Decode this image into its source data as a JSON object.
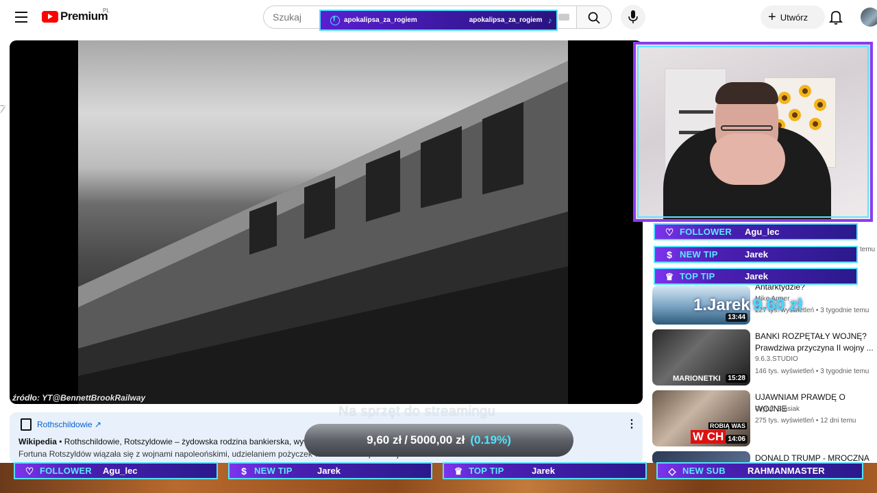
{
  "header": {
    "logo_text": "Premium",
    "region": "PL",
    "search_placeholder": "Szukaj",
    "create_label": "Utwórz"
  },
  "social_banner": {
    "facebook": "apokalipsa_za_rogiem",
    "tiktok": "apokalipsa_za_rogiem"
  },
  "video": {
    "credit": "źródło: YT@BennettBrookRailway"
  },
  "info_panel": {
    "title": "Rothschildowie ↗",
    "line1_source": "Wikipedia",
    "line1_text": " • Rothschildowie, Rotszyldowie – żydowska rodzina bankierska, wywodząca się z Frankfurtu nad Menem.",
    "line2_text": "Fortuna Rotszyldów wiązała się z wojnami napoleońskimi, udzielaniem pożyczek władcom i ze spekulacjami."
  },
  "right_alerts": [
    {
      "label": "FOLLOWER",
      "name": "Agu_lec",
      "icon": "heart-icon"
    },
    {
      "label": "NEW TIP",
      "name": "Jarek",
      "icon": "dollar-icon"
    },
    {
      "label": "TOP TIP",
      "name": "Jarek",
      "icon": "crown-icon"
    }
  ],
  "bottom_alerts": [
    {
      "label": "FOLLOWER",
      "name": "Agu_lec",
      "icon": "heart-icon"
    },
    {
      "label": "NEW TIP",
      "name": "Jarek",
      "icon": "dollar-icon"
    },
    {
      "label": "TOP TIP",
      "name": "Jarek",
      "icon": "crown-icon"
    },
    {
      "label": "NEW SUB",
      "name": "RAHMANMASTER",
      "icon": "diamond-icon"
    }
  ],
  "recommendations": [
    {
      "title": "Antarktydzie?",
      "channel": "Mike Armer",
      "meta": "227 tys. wyświetleń • 3 tygodnie temu",
      "duration": "13:44"
    },
    {
      "title": "BANKI ROZPĘTAŁY WOJNĘ? Prawdziwa przyczyna II wojny ...",
      "channel": "9.6.3.STUDIO",
      "meta": "146 tys. wyświetleń • 3 tygodnie temu",
      "duration": "15:28",
      "thumb_text": "MARIONETKI"
    },
    {
      "title": "UJAWNIAM PRAWDĘ O WOJNIE",
      "channel": "Crypto Stasiak",
      "meta": "275 tys. wyświetleń • 12 dni temu",
      "duration": "14:06",
      "thumb_text_1": "ROBIĄ WAS",
      "thumb_text_2": "W CH"
    },
    {
      "title": "DONALD TRUMP -  MROCZNA"
    }
  ],
  "recommendation_partial_meta": "temu",
  "overlays": {
    "caption": "Na sprzęt do streamingu",
    "goal_current": "9,60 zł",
    "goal_separator": "/",
    "goal_target": "5000,00 zł",
    "goal_percent": "(0.19%)",
    "goal_progress_fraction": 0.0019,
    "tip_name": "1.Jarek",
    "tip_amount": "9.60 zł"
  },
  "colors": {
    "alert_border": "#52e3ff",
    "alert_label": "#5de9ff",
    "alert_bg": "#4b1fb3",
    "link": "#065fd4"
  }
}
